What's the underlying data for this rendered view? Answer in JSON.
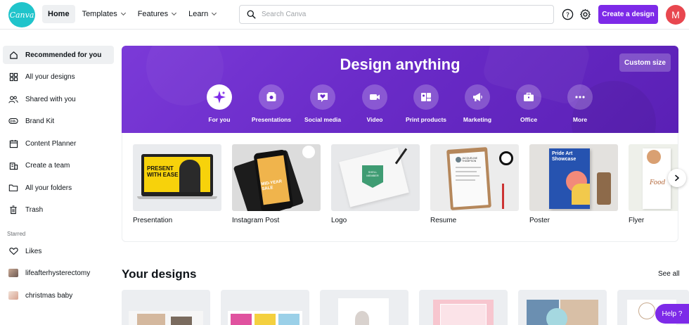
{
  "brand": {
    "logo_text": "Canva",
    "accent": "#7d2ae8",
    "logo_color": "#20c4cb"
  },
  "nav": {
    "items": [
      {
        "label": "Home",
        "active": true
      },
      {
        "label": "Templates",
        "dropdown": true
      },
      {
        "label": "Features",
        "dropdown": true
      },
      {
        "label": "Learn",
        "dropdown": true
      }
    ]
  },
  "search": {
    "placeholder": "Search Canva",
    "icon": "search-icon"
  },
  "header": {
    "help_icon": "question-circle-icon",
    "settings_icon": "gear-icon",
    "create_label": "Create a design",
    "avatar_initial": "M",
    "avatar_color": "#e8474f"
  },
  "sidebar": {
    "items": [
      {
        "label": "Recommended for you",
        "icon": "home-icon",
        "active": true
      },
      {
        "label": "All your designs",
        "icon": "grid-icon"
      },
      {
        "label": "Shared with you",
        "icon": "people-icon"
      },
      {
        "label": "Brand Kit",
        "icon": "brand-kit-icon"
      },
      {
        "label": "Content Planner",
        "icon": "calendar-icon"
      },
      {
        "label": "Create a team",
        "icon": "team-icon"
      },
      {
        "label": "All your folders",
        "icon": "folder-icon"
      },
      {
        "label": "Trash",
        "icon": "trash-icon"
      }
    ],
    "starred_heading": "Starred",
    "starred": [
      {
        "label": "Likes",
        "icon": "heart-icon"
      },
      {
        "label": "lifeafterhysterectomy",
        "icon": "design-thumbnail"
      },
      {
        "label": "christmas baby",
        "icon": "design-thumbnail"
      }
    ]
  },
  "hero": {
    "title": "Design anything",
    "custom_size_label": "Custom size",
    "categories": [
      {
        "label": "For you",
        "icon": "sparkle-icon",
        "active": true
      },
      {
        "label": "Presentations",
        "icon": "presentation-icon"
      },
      {
        "label": "Social media",
        "icon": "heart-speech-icon"
      },
      {
        "label": "Video",
        "icon": "video-camera-icon"
      },
      {
        "label": "Print products",
        "icon": "print-icon"
      },
      {
        "label": "Marketing",
        "icon": "megaphone-icon"
      },
      {
        "label": "Office",
        "icon": "briefcase-icon"
      },
      {
        "label": "More",
        "icon": "more-dots-icon"
      }
    ]
  },
  "templates": [
    {
      "label": "Presentation",
      "thumb_text": "PRESENT WITH EASE"
    },
    {
      "label": "Instagram Post",
      "thumb_text": "MID-YEAR SALE"
    },
    {
      "label": "Logo",
      "thumb_text": "SHELL MEMBER"
    },
    {
      "label": "Resume",
      "thumb_text": "JACQUELINE THOMPSON"
    },
    {
      "label": "Poster",
      "thumb_text": "Pride Art Showcase"
    },
    {
      "label": "Flyer",
      "thumb_text": "Food"
    }
  ],
  "your_designs": {
    "title": "Your designs",
    "see_all_label": "See all"
  },
  "help_label": "Help ?"
}
